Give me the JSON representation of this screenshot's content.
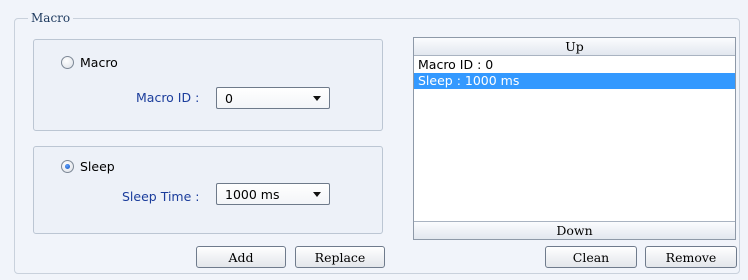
{
  "group": {
    "title": "Macro"
  },
  "macro_panel": {
    "radio_label": "Macro",
    "radio_checked": false,
    "macro_id_label": "Macro ID :",
    "macro_id_value": "0"
  },
  "sleep_panel": {
    "radio_label": "Sleep",
    "radio_checked": true,
    "sleep_time_label": "Sleep Time :",
    "sleep_time_value": "1000 ms"
  },
  "list": {
    "up_label": "Up",
    "down_label": "Down",
    "items": [
      {
        "text": "Macro ID : 0",
        "selected": false
      },
      {
        "text": "Sleep : 1000 ms",
        "selected": true
      }
    ]
  },
  "buttons": {
    "add": "Add",
    "replace": "Replace",
    "clean": "Clean",
    "remove": "Remove"
  },
  "colors": {
    "background": "#f1f4fa",
    "field_label": "#1b3d9c",
    "selection": "#3399ff"
  }
}
